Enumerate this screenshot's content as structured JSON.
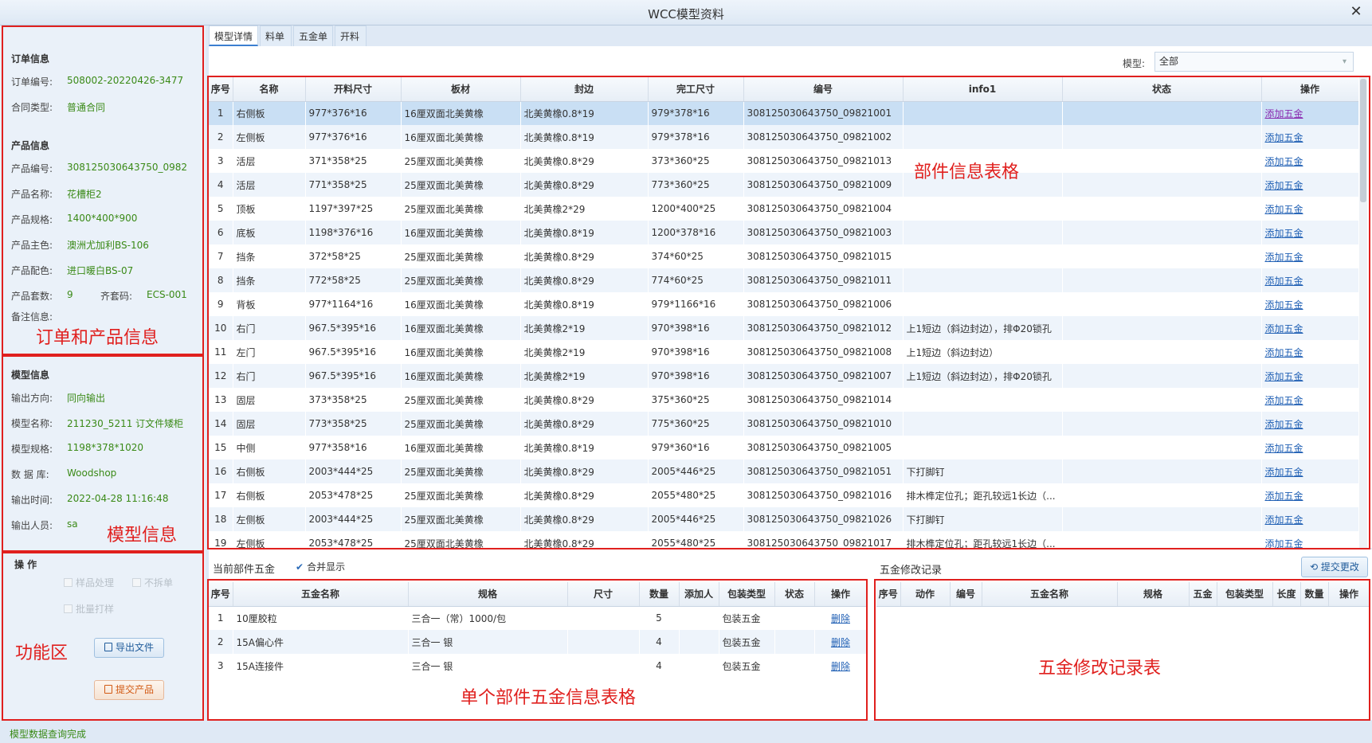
{
  "window": {
    "title": "WCC模型资料",
    "close": "✕"
  },
  "tabs": [
    "模型详情",
    "料单",
    "五金单",
    "开料"
  ],
  "order": {
    "heading": "订单信息",
    "no_label": "订单编号:",
    "no": "508002-20220426-3477",
    "type_label": "合同类型:",
    "type": "普通合同"
  },
  "product": {
    "heading": "产品信息",
    "code_label": "产品编号:",
    "code": "308125030643750_0982",
    "name_label": "产品名称:",
    "name": "花槽柜2",
    "spec_label": "产品规格:",
    "spec": "1400*400*900",
    "main_color_label": "产品主色:",
    "main_color": "澳洲尤加利BS-106",
    "sub_color_label": "产品配色:",
    "sub_color": "进口暖白BS-07",
    "sets_label": "产品套数:",
    "sets": "9",
    "kit_label": "齐套码:",
    "kit": "ECS-001",
    "remark_label": "备注信息:"
  },
  "model_info": {
    "heading": "模型信息",
    "dir_label": "输出方向:",
    "dir": "同向输出",
    "name_label": "模型名称:",
    "name": "211230_5211 订文件矮柜",
    "spec_label": "模型规格:",
    "spec": "1198*378*1020",
    "db_label": "数 据 库:",
    "db": "Woodshop",
    "time_label": "输出时间:",
    "time": "2022-04-28 11:16:48",
    "user_label": "输出人员:",
    "user": "sa"
  },
  "ops": {
    "heading": "操 作",
    "sample": "样品处理",
    "nosplit": "不拆单",
    "batch_print": "批量打样",
    "export": "导出文件",
    "submit": "提交产品"
  },
  "annotations": {
    "order_product": "订单和产品信息",
    "model": "模型信息",
    "ops": "功能区",
    "parts": "部件信息表格",
    "hardware": "单个部件五金信息表格",
    "log": "五金修改记录表"
  },
  "model_filter": {
    "label": "模型:",
    "value": "全部"
  },
  "parts": {
    "columns": [
      "序号",
      "名称",
      "开料尺寸",
      "板材",
      "封边",
      "完工尺寸",
      "编号",
      "info1",
      "状态",
      "操作"
    ],
    "action": "添加五金",
    "rows": [
      [
        "1",
        "右侧板",
        "977*376*16",
        "16厘双面北美黄橡",
        "北美黄橡0.8*19",
        "979*378*16",
        "308125030643750_09821001",
        ""
      ],
      [
        "2",
        "左侧板",
        "977*376*16",
        "16厘双面北美黄橡",
        "北美黄橡0.8*19",
        "979*378*16",
        "308125030643750_09821002",
        ""
      ],
      [
        "3",
        "活层",
        "371*358*25",
        "25厘双面北美黄橡",
        "北美黄橡0.8*29",
        "373*360*25",
        "308125030643750_09821013",
        ""
      ],
      [
        "4",
        "活层",
        "771*358*25",
        "25厘双面北美黄橡",
        "北美黄橡0.8*29",
        "773*360*25",
        "308125030643750_09821009",
        ""
      ],
      [
        "5",
        "顶板",
        "1197*397*25",
        "25厘双面北美黄橡",
        "北美黄橡2*29",
        "1200*400*25",
        "308125030643750_09821004",
        ""
      ],
      [
        "6",
        "底板",
        "1198*376*16",
        "16厘双面北美黄橡",
        "北美黄橡0.8*19",
        "1200*378*16",
        "308125030643750_09821003",
        ""
      ],
      [
        "7",
        "挡条",
        "372*58*25",
        "25厘双面北美黄橡",
        "北美黄橡0.8*29",
        "374*60*25",
        "308125030643750_09821015",
        ""
      ],
      [
        "8",
        "挡条",
        "772*58*25",
        "25厘双面北美黄橡",
        "北美黄橡0.8*29",
        "774*60*25",
        "308125030643750_09821011",
        ""
      ],
      [
        "9",
        "背板",
        "977*1164*16",
        "16厘双面北美黄橡",
        "北美黄橡0.8*19",
        "979*1166*16",
        "308125030643750_09821006",
        ""
      ],
      [
        "10",
        "右门",
        "967.5*395*16",
        "16厘双面北美黄橡",
        "北美黄橡2*19",
        "970*398*16",
        "308125030643750_09821012",
        "上1短边（斜边封边），排Φ20锁孔"
      ],
      [
        "11",
        "左门",
        "967.5*395*16",
        "16厘双面北美黄橡",
        "北美黄橡2*19",
        "970*398*16",
        "308125030643750_09821008",
        "上1短边（斜边封边）"
      ],
      [
        "12",
        "右门",
        "967.5*395*16",
        "16厘双面北美黄橡",
        "北美黄橡2*19",
        "970*398*16",
        "308125030643750_09821007",
        "上1短边（斜边封边），排Φ20锁孔"
      ],
      [
        "13",
        "固层",
        "373*358*25",
        "25厘双面北美黄橡",
        "北美黄橡0.8*29",
        "375*360*25",
        "308125030643750_09821014",
        ""
      ],
      [
        "14",
        "固层",
        "773*358*25",
        "25厘双面北美黄橡",
        "北美黄橡0.8*29",
        "775*360*25",
        "308125030643750_09821010",
        ""
      ],
      [
        "15",
        "中侧",
        "977*358*16",
        "16厘双面北美黄橡",
        "北美黄橡0.8*19",
        "979*360*16",
        "308125030643750_09821005",
        ""
      ],
      [
        "16",
        "右侧板",
        "2003*444*25",
        "25厘双面北美黄橡",
        "北美黄橡0.8*29",
        "2005*446*25",
        "308125030643750_09821051",
        "下打脚钉"
      ],
      [
        "17",
        "右侧板",
        "2053*478*25",
        "25厘双面北美黄橡",
        "北美黄橡0.8*29",
        "2055*480*25",
        "308125030643750_09821016",
        "排木榫定位孔；距孔较远1长边（..."
      ],
      [
        "18",
        "左侧板",
        "2003*444*25",
        "25厘双面北美黄橡",
        "北美黄橡0.8*29",
        "2005*446*25",
        "308125030643750_09821026",
        "下打脚钉"
      ],
      [
        "19",
        "左侧板",
        "2053*478*25",
        "25厘双面北美黄橡",
        "北美黄橡0.8*29",
        "2055*480*25",
        "308125030643750_09821017",
        "排木榫定位孔；距孔较远1长边（..."
      ]
    ]
  },
  "hardware": {
    "title": "当前部件五金",
    "merge": "合并显示",
    "columns": [
      "序号",
      "五金名称",
      "规格",
      "尺寸",
      "数量",
      "添加人",
      "包装类型",
      "状态",
      "操作"
    ],
    "action": "删除",
    "rows": [
      [
        "1",
        "10厘胶粒",
        "三合一（常）1000/包",
        "",
        "5",
        "",
        "包装五金",
        ""
      ],
      [
        "2",
        "15A偏心件",
        "三合一 银",
        "",
        "4",
        "",
        "包装五金",
        ""
      ],
      [
        "3",
        "15A连接件",
        "三合一 银",
        "",
        "4",
        "",
        "包装五金",
        ""
      ]
    ]
  },
  "log": {
    "title": "五金修改记录",
    "submit": "提交更改",
    "columns": [
      "序号",
      "动作",
      "编号",
      "五金名称",
      "规格",
      "五金",
      "包装类型",
      "长度",
      "数量",
      "操作"
    ]
  },
  "status_text": "模型数据查询完成"
}
